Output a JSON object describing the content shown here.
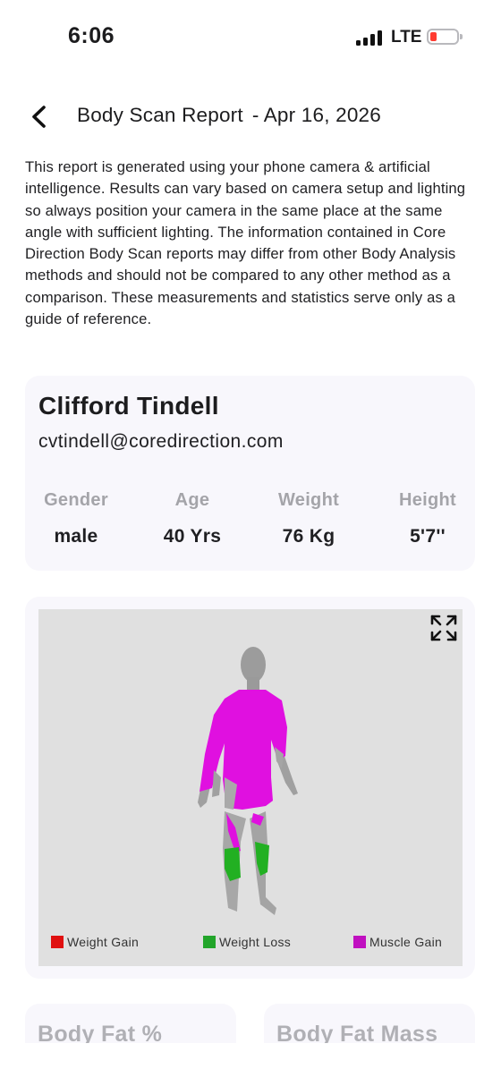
{
  "status_bar": {
    "time": "6:06",
    "network": "LTE",
    "battery_level": 0.15
  },
  "header": {
    "title": "Body Scan Report",
    "date": "- Apr 16, 2026",
    "back_icon": "chevron-left-icon"
  },
  "disclaimer": "This report is generated using your phone camera & artificial intelligence. Results can vary based on camera setup and lighting so always position your camera in the same place at the same angle with sufficient lighting. The information contained in Core Direction Body Scan reports may differ from other Body Analysis methods and should not be compared to any other method as a comparison. These measurements and statistics serve only as a guide of reference.",
  "profile": {
    "name": "Clifford Tindell",
    "email": "cvtindell@coredirection.com",
    "stats": [
      {
        "label": "Gender",
        "value": "male"
      },
      {
        "label": "Age",
        "value": "40 Yrs"
      },
      {
        "label": "Weight",
        "value": "76 Kg"
      },
      {
        "label": "Height",
        "value": "5'7''"
      }
    ]
  },
  "model_viewer": {
    "expand_icon": "expand-arrows-icon",
    "legend": [
      {
        "label": "Weight Gain",
        "color": "#e01010"
      },
      {
        "label": "Weight Loss",
        "color": "#22a52a"
      },
      {
        "label": "Muscle Gain",
        "color": "#c010c0"
      }
    ]
  },
  "metrics": [
    {
      "title": "Body Fat %"
    },
    {
      "title": "Body Fat Mass"
    }
  ]
}
